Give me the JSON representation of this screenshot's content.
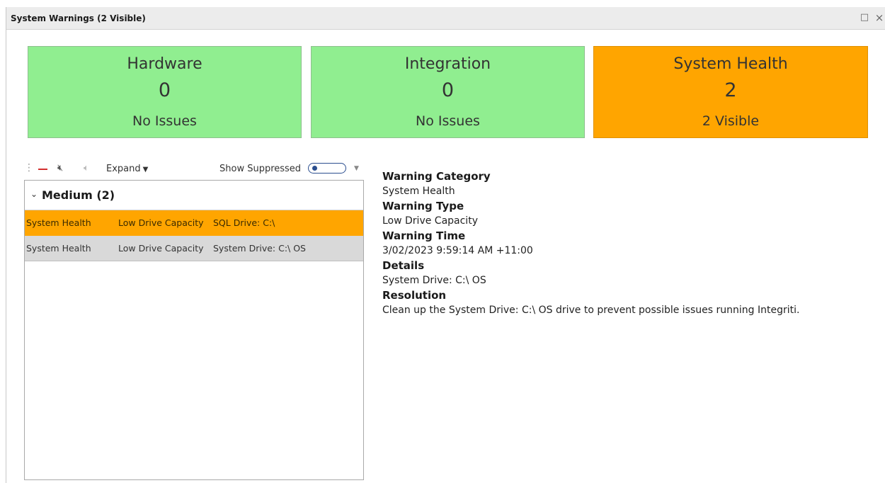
{
  "window": {
    "title": "System Warnings (2 Visible)",
    "maximize_icon": "□",
    "close_icon": "×"
  },
  "cards": [
    {
      "title": "Hardware",
      "count": "0",
      "status": "No Issues",
      "color": "#90ee90"
    },
    {
      "title": "Integration",
      "count": "0",
      "status": "No Issues",
      "color": "#90ee90"
    },
    {
      "title": "System Health",
      "count": "2",
      "status": "2 Visible",
      "color": "#ffa500"
    }
  ],
  "toolbar": {
    "expand_label": "Expand",
    "show_suppressed_label": "Show Suppressed",
    "show_suppressed_value": false,
    "icons": [
      "grip-icon",
      "remove-icon",
      "mute-icon",
      "unmute-icon",
      "chevron-down-icon"
    ]
  },
  "grid": {
    "group_label": "Medium (2)",
    "rows": [
      {
        "category": "System Health",
        "type": "Low Drive Capacity",
        "details": "SQL Drive: C:\\",
        "selected": true
      },
      {
        "category": "System Health",
        "type": "Low Drive Capacity",
        "details": "System Drive: C:\\ OS",
        "selected": false
      }
    ]
  },
  "details": {
    "category_label": "Warning Category",
    "category_value": "System Health",
    "type_label": "Warning Type",
    "type_value": "Low Drive Capacity",
    "time_label": "Warning Time",
    "time_value": "3/02/2023 9:59:14 AM +11:00",
    "details_label": "Details",
    "details_value": "System Drive: C:\\ OS",
    "resolution_label": "Resolution",
    "resolution_value": "Clean up the System Drive: C:\\ OS drive to prevent possible issues running Integriti."
  },
  "colors": {
    "ok": "#90ee90",
    "warning": "#ffa500",
    "selected_row": "#ffa500",
    "alt_row": "#d9d9d9"
  }
}
